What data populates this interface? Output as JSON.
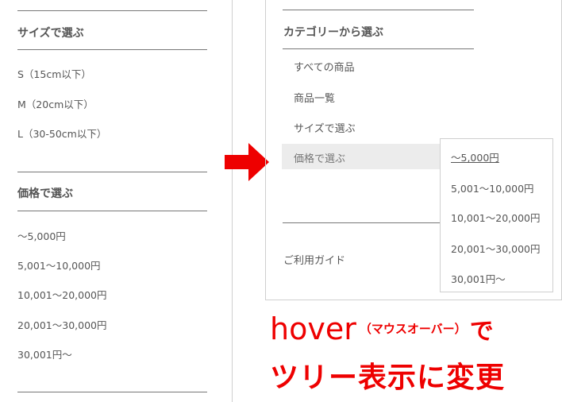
{
  "left_panel": {
    "size_heading": "サイズで選ぶ",
    "size_items": [
      "S（15cm以下）",
      "M（20cm以下）",
      "L（30-50cm以下）"
    ],
    "price_heading": "価格で選ぶ",
    "price_items": [
      "〜5,000円",
      "5,001〜10,000円",
      "10,001〜20,000円",
      "20,001〜30,000円",
      "30,001円〜"
    ]
  },
  "right_panel": {
    "category_heading": "カテゴリーから選ぶ",
    "menu_items": [
      "すべての商品",
      "商品一覧",
      "サイズで選ぶ",
      "価格で選ぶ"
    ],
    "guide_link": "ご利用ガイド",
    "dropdown_items": [
      "〜5,000円",
      "5,001〜10,000円",
      "10,001〜20,000円",
      "20,001〜30,000円",
      "30,001円〜"
    ]
  },
  "annotation": {
    "line1_main": "hover",
    "line1_paren": "（マウスオーバー）",
    "line1_end": "で",
    "line2": "ツリー表示に変更"
  },
  "colors": {
    "annotation": "#ee0000",
    "arrow": "#ee0000",
    "hover_bg": "#ececec"
  },
  "icons": {
    "arrow": "right-arrow-icon"
  }
}
